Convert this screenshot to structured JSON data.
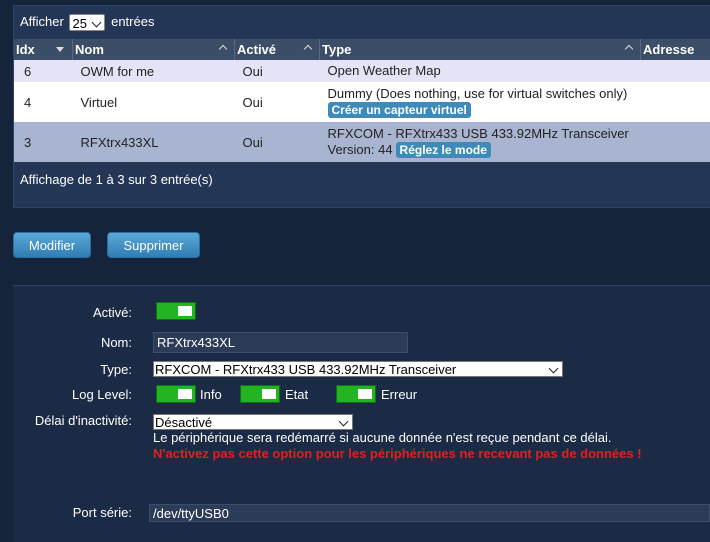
{
  "table_controls": {
    "show_prefix": "Afficher",
    "page_size": "25",
    "show_suffix": "entrées",
    "info": "Affichage de 1 à 3 sur 3 entrée(s)"
  },
  "table": {
    "columns": [
      "Idx",
      "Nom",
      "Activé",
      "Type",
      "Adresse"
    ],
    "rows": [
      {
        "idx": "6",
        "name": "OWM for me",
        "enabled": "Oui",
        "type_line1": "Open Weather Map",
        "type_line2": "",
        "action": "",
        "address": ""
      },
      {
        "idx": "4",
        "name": "Virtuel",
        "enabled": "Oui",
        "type_line1": "Dummy (Does nothing, use for virtual switches only)",
        "type_line2": "",
        "action": "Créer un capteur virtuel",
        "address": ""
      },
      {
        "idx": "3",
        "name": "RFXtrx433XL",
        "enabled": "Oui",
        "type_line1": "RFXCOM - RFXtrx433 USB 433.92MHz Transceiver",
        "type_line2": "Version: 44",
        "action": "Réglez le mode",
        "address": ""
      }
    ]
  },
  "actions": {
    "modify": "Modifier",
    "delete": "Supprimer"
  },
  "form": {
    "enabled_label": "Activé:",
    "name_label": "Nom:",
    "name_value": "RFXtrx433XL",
    "type_label": "Type:",
    "type_value": "RFXCOM - RFXtrx433 USB 433.92MHz Transceiver",
    "log_label": "Log Level:",
    "log_info": "Info",
    "log_status": "Etat",
    "log_error": "Erreur",
    "timeout_label": "Délai d'inactivité:",
    "timeout_value": "Désactivé",
    "timeout_help": "Le périphérique sera redémarré si aucune donnée n'est reçue pendant ce délai.",
    "timeout_warning": "N'activez pas cette option pour les périphériques ne recevant pas de données !",
    "port_label": "Port série:",
    "port_value": "/dev/ttyUSB0"
  },
  "colors": {
    "background": "#16243b",
    "toggle_on": "#22b422",
    "warning": "#e02020",
    "button": "#3e8ab8"
  }
}
